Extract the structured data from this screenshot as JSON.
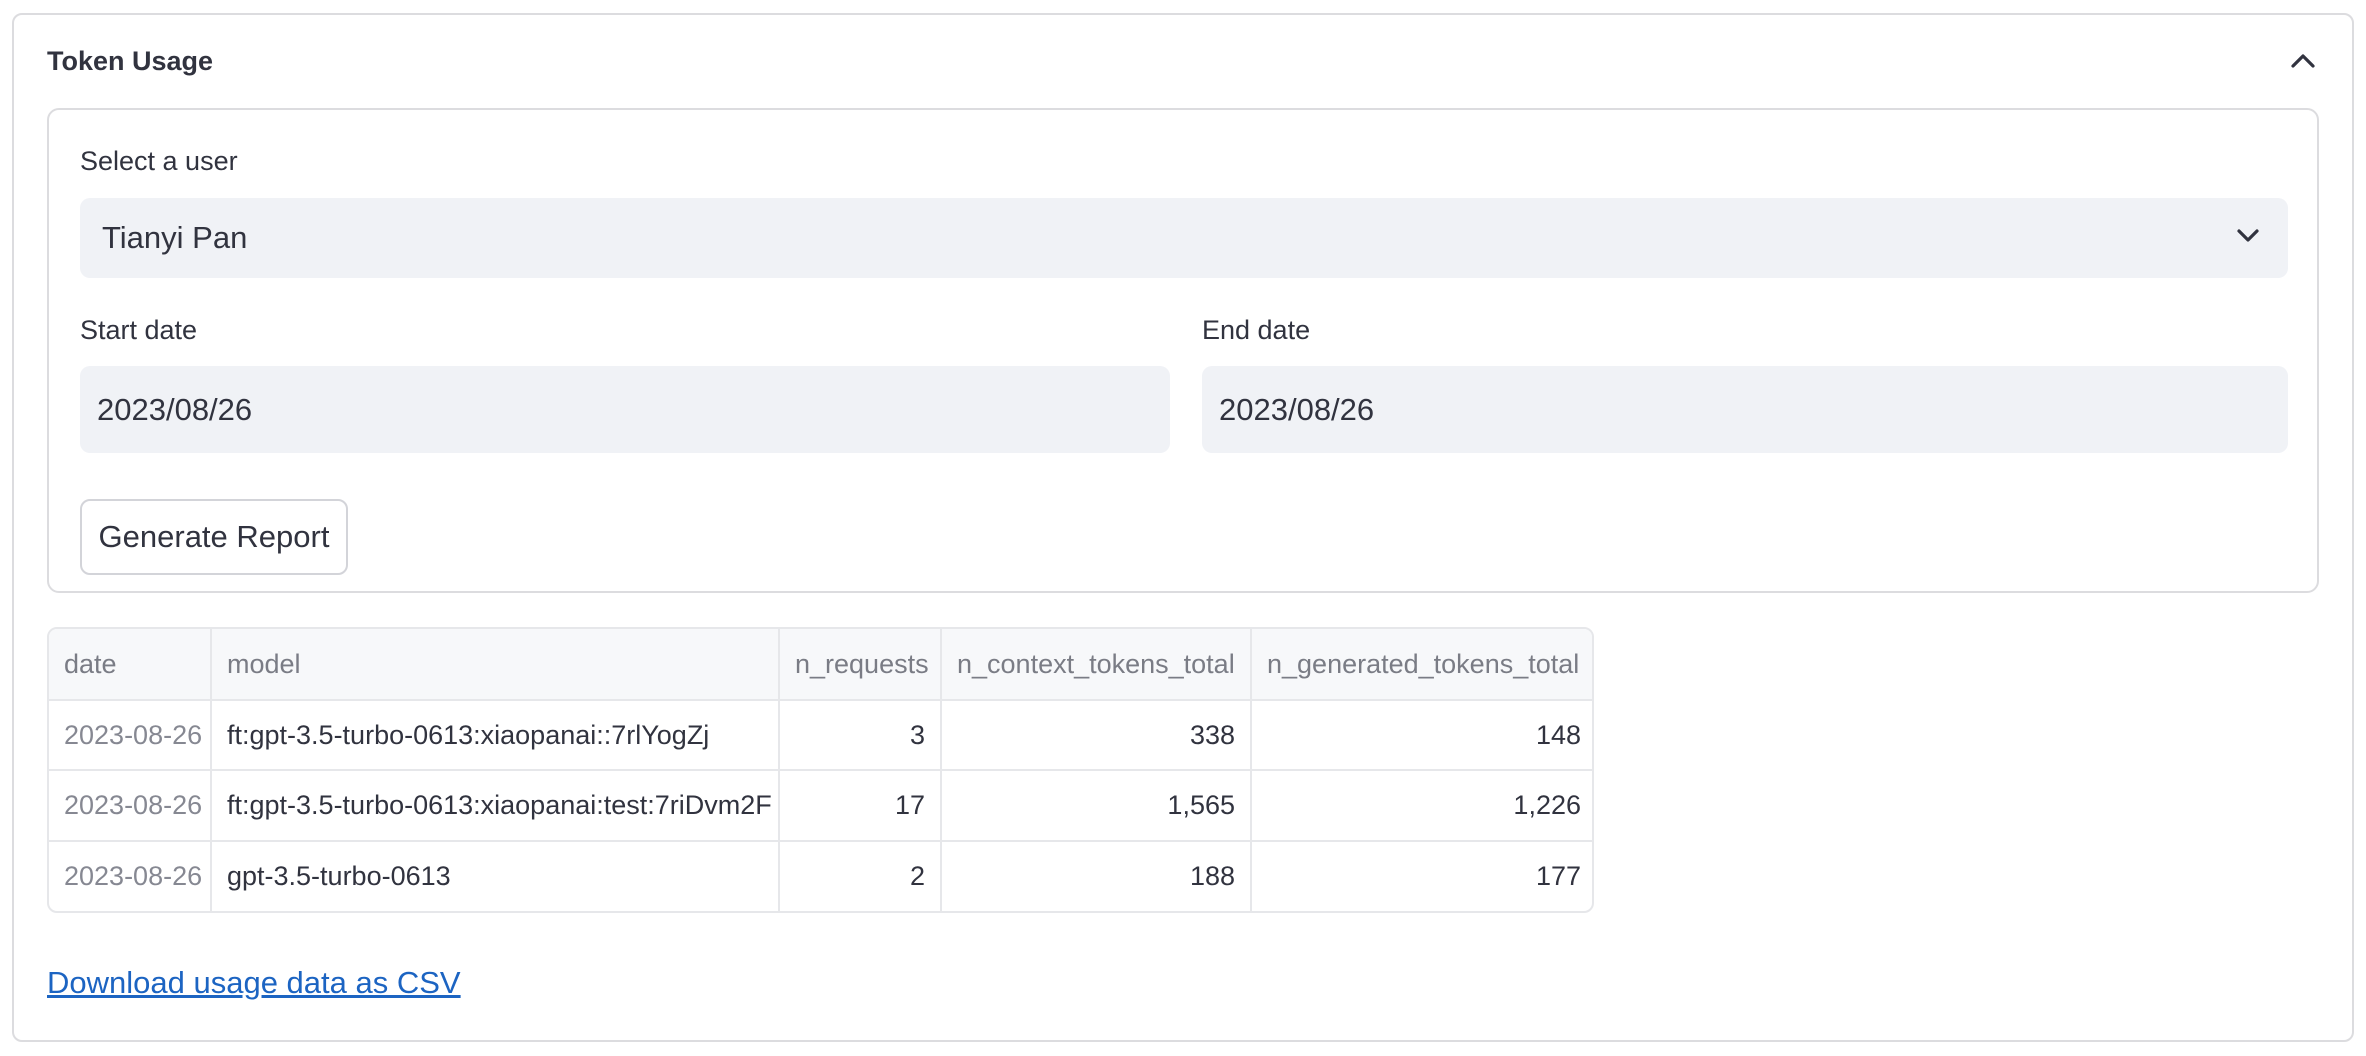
{
  "expander": {
    "title": "Token Usage",
    "toggle_icon": "chevron-up-icon"
  },
  "form": {
    "user_label": "Select a user",
    "user_value": "Tianyi Pan",
    "start_label": "Start date",
    "start_value": "2023/08/26",
    "end_label": "End date",
    "end_value": "2023/08/26",
    "button_label": "Generate Report"
  },
  "table": {
    "columns": [
      "date",
      "model",
      "n_requests",
      "n_context_tokens_total",
      "n_generated_tokens_total"
    ],
    "rows": [
      [
        "2023-08-26",
        "ft:gpt-3.5-turbo-0613:xiaopanai::7rlYogZj",
        "3",
        "338",
        "148"
      ],
      [
        "2023-08-26",
        "ft:gpt-3.5-turbo-0613:xiaopanai:test:7riDvm2F",
        "17",
        "1,565",
        "1,226"
      ],
      [
        "2023-08-26",
        "gpt-3.5-turbo-0613",
        "2",
        "188",
        "177"
      ]
    ]
  },
  "download": {
    "label": "Download usage data as CSV"
  },
  "colors": {
    "accent_link": "#1c64c2",
    "input_bg": "#f0f2f6",
    "text": "#31333f"
  }
}
